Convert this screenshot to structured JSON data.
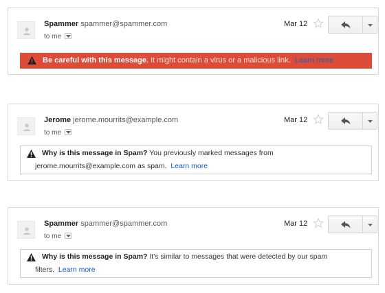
{
  "messages": [
    {
      "sender_name": "Spammer",
      "sender_email": "spammer@spammer.com",
      "to_label": "to me",
      "date": "Mar 12",
      "warning": {
        "style": "danger",
        "bold": "Be careful with this message.",
        "text": " It might contain a virus or a malicious link.",
        "link": "Learn more"
      }
    },
    {
      "sender_name": "Jerome",
      "sender_email": "jerome.mourrits@example.com",
      "to_label": "to me",
      "date": "Mar 12",
      "warning": {
        "style": "spam",
        "bold": "Why is this message in Spam?",
        "text_line1": " You previously marked messages from",
        "text_line2": "jerome.mourrits@example.com as spam.",
        "link": "Learn more"
      }
    },
    {
      "sender_name": "Spammer",
      "sender_email": "spammer@spammer.com",
      "to_label": "to me",
      "date": "Mar 12",
      "warning": {
        "style": "spam",
        "bold": "Why is this message in Spam?",
        "text_line1": " It's similar to messages that were detected by our spam",
        "text_line2": "filters.",
        "link": "Learn more"
      }
    }
  ],
  "colors": {
    "danger_bg": "#dd4b39",
    "link": "#1155cc",
    "border": "#d8d8d8"
  },
  "icons": [
    "avatar-icon",
    "star-icon",
    "reply-icon",
    "chevron-down-icon",
    "warning-icon"
  ]
}
